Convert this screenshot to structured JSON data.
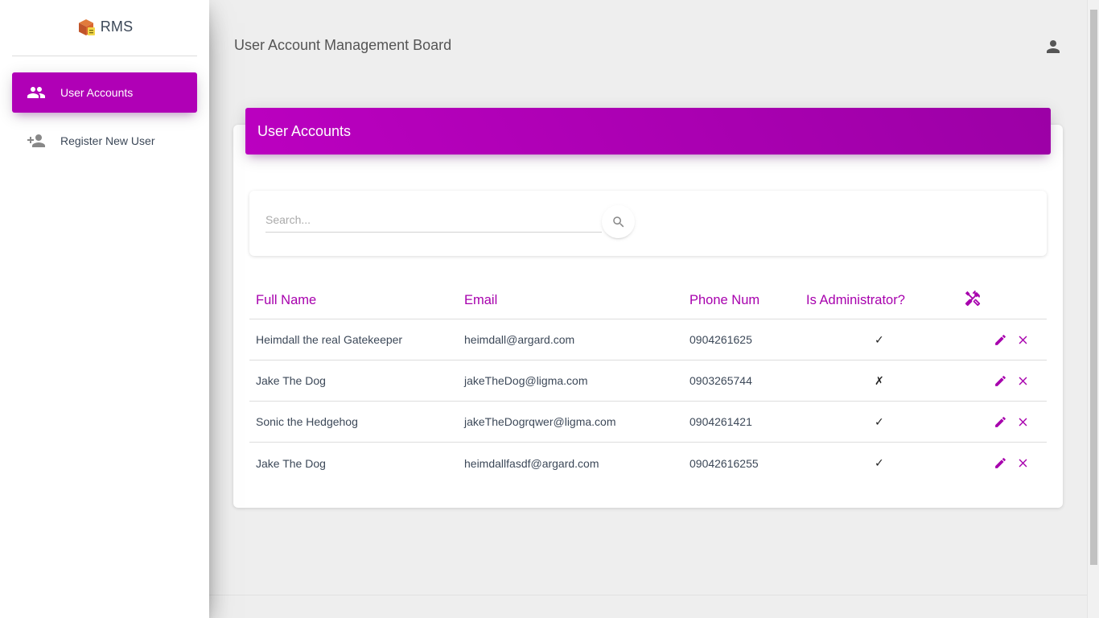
{
  "brand": {
    "name": "RMS"
  },
  "sidebar": {
    "items": [
      {
        "label": "User Accounts",
        "icon": "people-icon",
        "active": true
      },
      {
        "label": "Register New User",
        "icon": "person-add-icon",
        "active": false
      }
    ]
  },
  "header": {
    "title": "User Account Management Board",
    "profile_icon": "person-icon"
  },
  "card": {
    "title": "User Accounts"
  },
  "search": {
    "placeholder": "Search...",
    "value": "",
    "icon": "search-icon"
  },
  "table": {
    "columns": [
      "Full Name",
      "Email",
      "Phone Num",
      "Is Administrator?"
    ],
    "tools_icon": "tools-icon",
    "rows": [
      {
        "name": "Heimdall the real Gatekeeper",
        "email": "heimdall@argard.com",
        "phone": "0904261625",
        "admin": "✓"
      },
      {
        "name": "Jake The Dog",
        "email": "jakeTheDog@ligma.com",
        "phone": "0903265744",
        "admin": "✗"
      },
      {
        "name": "Sonic the Hedgehog",
        "email": "jakeTheDogrqwer@ligma.com",
        "phone": "0904261421",
        "admin": "✓"
      },
      {
        "name": "Jake The Dog",
        "email": "heimdallfasdf@argard.com",
        "phone": "09042616255",
        "admin": "✓"
      }
    ]
  },
  "colors": {
    "accent": "#b000b6",
    "accent_dark": "#9c00a6",
    "text": "#3c4858",
    "background": "#eeeeee"
  }
}
